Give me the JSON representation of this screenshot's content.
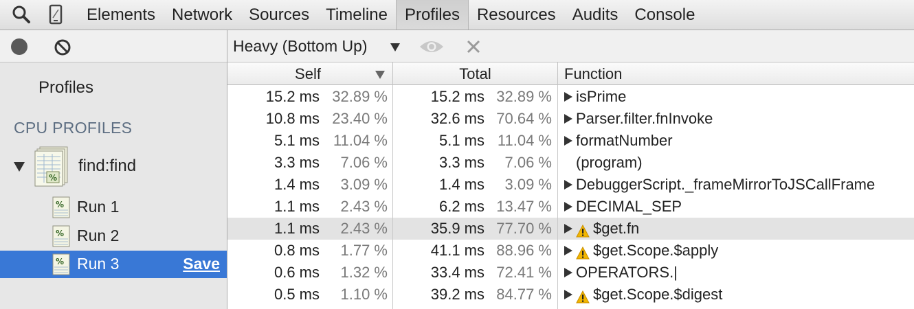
{
  "toolbar": {
    "search_icon": "search-icon",
    "device_icon": "device-mode-icon",
    "tabs": [
      {
        "label": "Elements",
        "active": false
      },
      {
        "label": "Network",
        "active": false
      },
      {
        "label": "Sources",
        "active": false
      },
      {
        "label": "Timeline",
        "active": false
      },
      {
        "label": "Profiles",
        "active": true
      },
      {
        "label": "Resources",
        "active": false
      },
      {
        "label": "Audits",
        "active": false
      },
      {
        "label": "Console",
        "active": false
      }
    ]
  },
  "sidebar": {
    "title": "Profiles",
    "section_header": "CPU PROFILES",
    "group": {
      "label": "find:find",
      "expanded": true
    },
    "runs": [
      {
        "label": "Run 1",
        "selected": false
      },
      {
        "label": "Run 2",
        "selected": false
      },
      {
        "label": "Run 3",
        "selected": true,
        "action": "Save"
      }
    ]
  },
  "main": {
    "view_mode": "Heavy (Bottom Up)",
    "columns": {
      "self": "Self",
      "total": "Total",
      "function": "Function"
    },
    "sort_column": "Self",
    "rows": [
      {
        "self_ms": "15.2 ms",
        "self_pct": "32.89 %",
        "total_ms": "15.2 ms",
        "total_pct": "32.89 %",
        "function": "isPrime",
        "expandable": true,
        "warning": false
      },
      {
        "self_ms": "10.8 ms",
        "self_pct": "23.40 %",
        "total_ms": "32.6 ms",
        "total_pct": "70.64 %",
        "function": "Parser.filter.fnInvoke",
        "expandable": true,
        "warning": false
      },
      {
        "self_ms": "5.1 ms",
        "self_pct": "11.04 %",
        "total_ms": "5.1 ms",
        "total_pct": "11.04 %",
        "function": "formatNumber",
        "expandable": true,
        "warning": false
      },
      {
        "self_ms": "3.3 ms",
        "self_pct": "7.06 %",
        "total_ms": "3.3 ms",
        "total_pct": "7.06 %",
        "function": "(program)",
        "expandable": false,
        "warning": false
      },
      {
        "self_ms": "1.4 ms",
        "self_pct": "3.09 %",
        "total_ms": "1.4 ms",
        "total_pct": "3.09 %",
        "function": "DebuggerScript._frameMirrorToJSCallFrame",
        "expandable": true,
        "warning": false
      },
      {
        "self_ms": "1.1 ms",
        "self_pct": "2.43 %",
        "total_ms": "6.2 ms",
        "total_pct": "13.47 %",
        "function": "DECIMAL_SEP",
        "expandable": true,
        "warning": false
      },
      {
        "self_ms": "1.1 ms",
        "self_pct": "2.43 %",
        "total_ms": "35.9 ms",
        "total_pct": "77.70 %",
        "function": "$get.fn",
        "expandable": true,
        "warning": true,
        "highlighted": true
      },
      {
        "self_ms": "0.8 ms",
        "self_pct": "1.77 %",
        "total_ms": "41.1 ms",
        "total_pct": "88.96 %",
        "function": "$get.Scope.$apply",
        "expandable": true,
        "warning": true
      },
      {
        "self_ms": "0.6 ms",
        "self_pct": "1.32 %",
        "total_ms": "33.4 ms",
        "total_pct": "72.41 %",
        "function": "OPERATORS.|",
        "expandable": true,
        "warning": false
      },
      {
        "self_ms": "0.5 ms",
        "self_pct": "1.10 %",
        "total_ms": "39.2 ms",
        "total_pct": "84.77 %",
        "function": "$get.Scope.$digest",
        "expandable": true,
        "warning": true
      }
    ]
  },
  "colors": {
    "selection": "#3978d6",
    "highlight_row": "#e3e3e3",
    "warning": "#f2b600"
  }
}
